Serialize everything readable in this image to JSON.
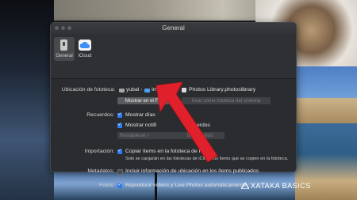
{
  "window": {
    "title": "General"
  },
  "toolbar": {
    "items": [
      {
        "label": "General",
        "icon": "general-icon",
        "selected": true
      },
      {
        "label": "iCloud",
        "icon": "icloud-icon",
        "selected": false
      }
    ]
  },
  "library": {
    "label": "Ubicación de fototeca:",
    "breadcrumb": [
      "yubal",
      "Imágenes",
      "Photos Library.photoslibrary"
    ],
    "show_in_finder": "Mostrar en el Finder",
    "use_as_system": "Usar como fototeca del sistema"
  },
  "memories": {
    "label": "Recuerdos:",
    "option1": "Mostrar días",
    "option2_start": "Mostrar notifi",
    "option2_end": "ecuerdos",
    "reset_start": "Restablecer r",
    "reset_end": "bloqueados"
  },
  "import": {
    "label": "Importación:",
    "option": "Copiar ítems en la fototeca de Fotos",
    "note": "Solo se cargarán en las fototecas de iCloud los ítems que se copien en la fototeca."
  },
  "metadata": {
    "label": "Metadatos:",
    "option": "Incluir información de ubicación en los ítems publicados"
  },
  "photos": {
    "label": "Fotos:",
    "option": "Reproducir vídeos y Live Photos automáticamente"
  },
  "watermark": {
    "text": "XATAKA BASICS"
  },
  "colors": {
    "accent": "#2f7bf0",
    "arrow": "#e0202a"
  }
}
